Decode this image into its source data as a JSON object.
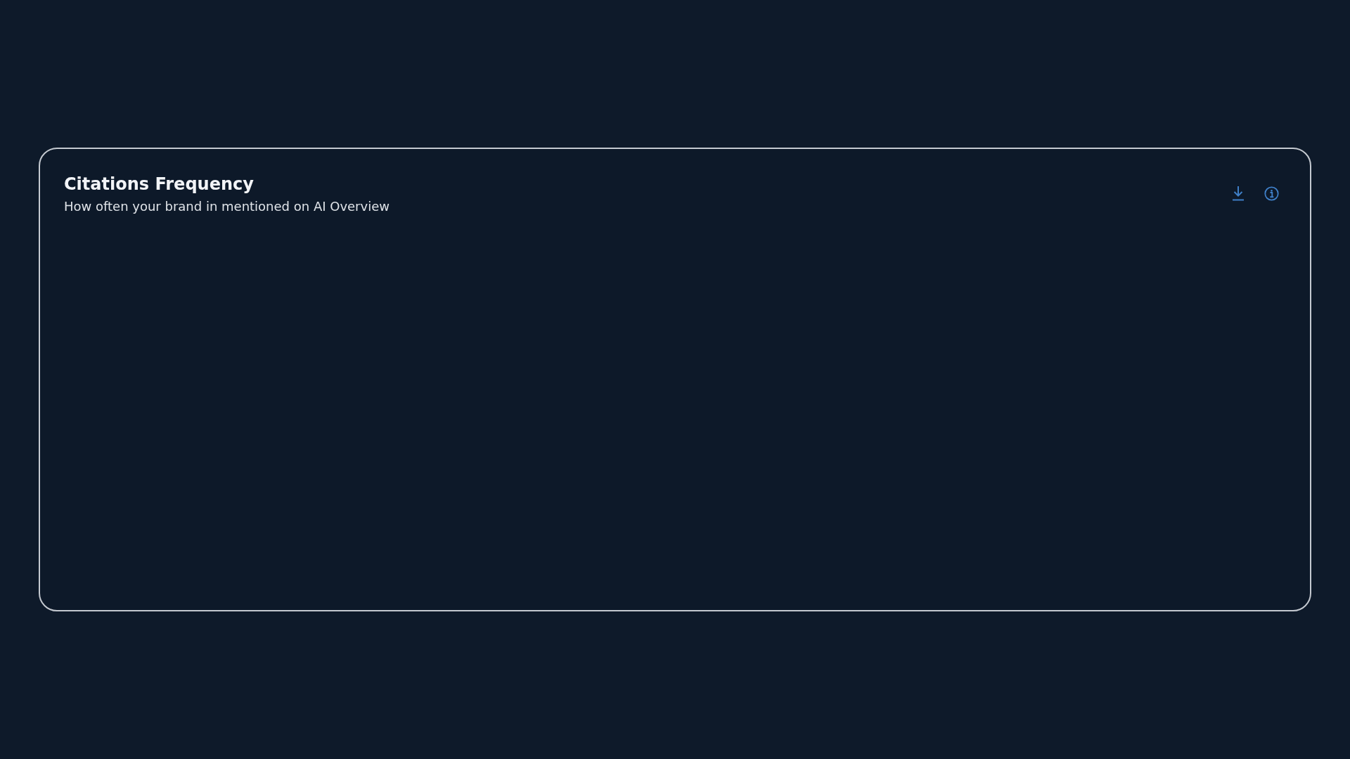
{
  "card": {
    "title": "Citations Frequency",
    "subtitle": "How often your brand in mentioned on AI Overview"
  }
}
